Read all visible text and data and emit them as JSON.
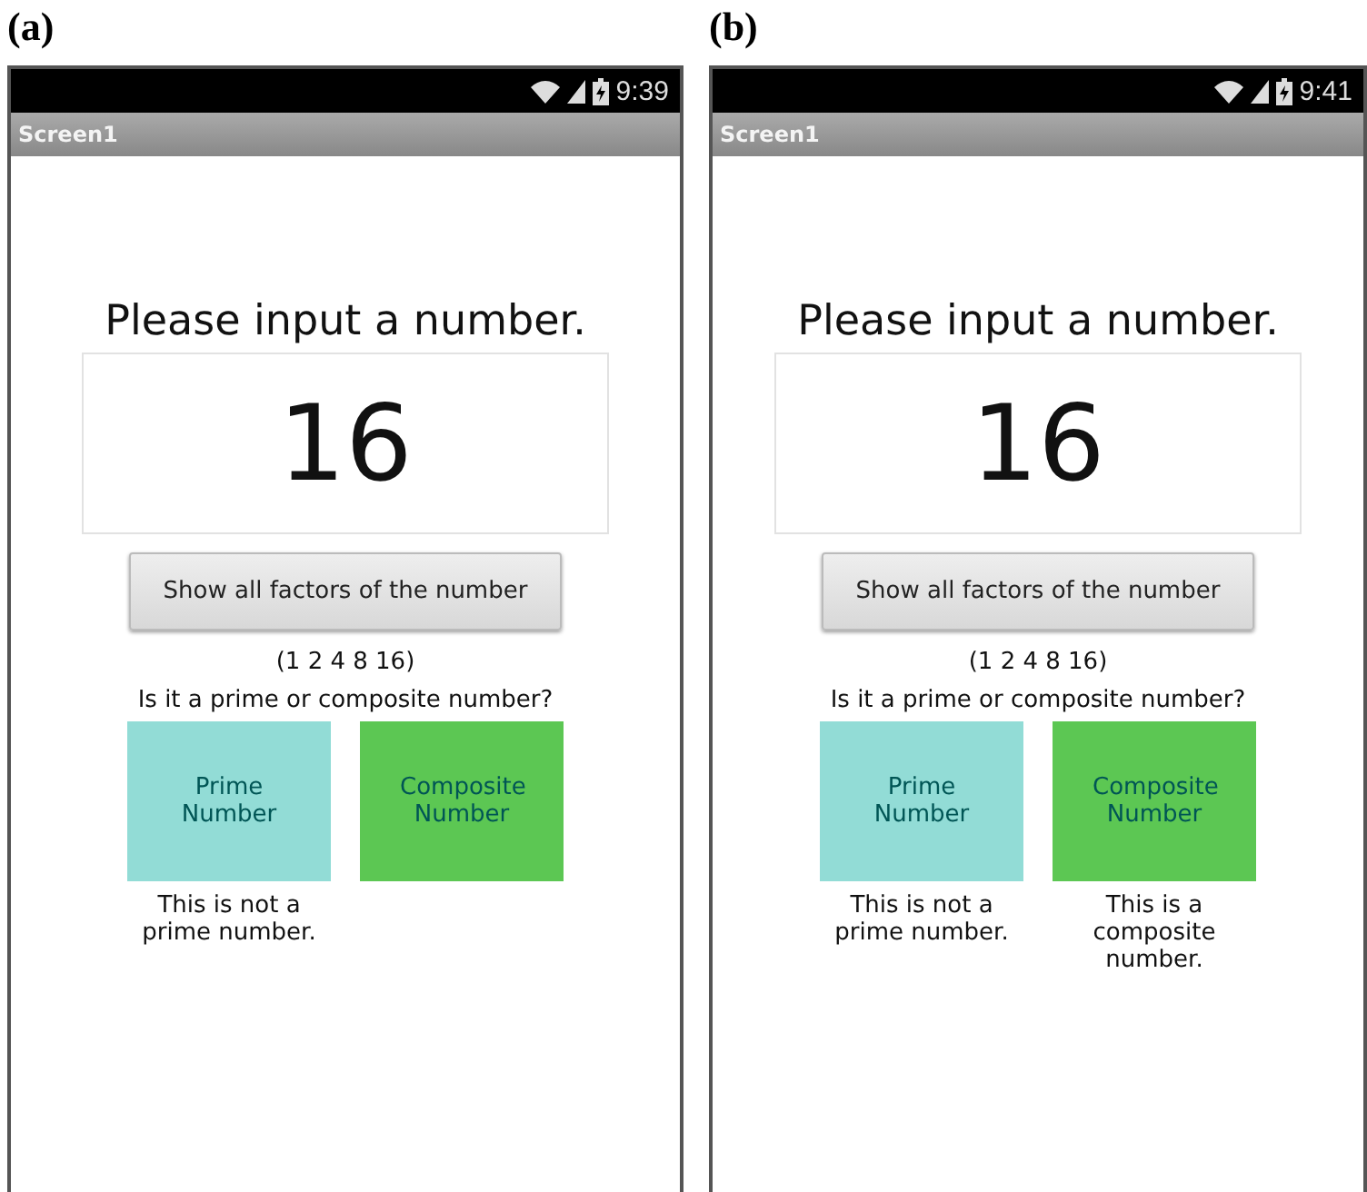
{
  "panels": [
    {
      "label": "(a)",
      "time": "9:39",
      "title": "Screen1",
      "prompt": "Please input a number.",
      "input": {
        "value": "16"
      },
      "button": "Show all factors of the number",
      "factors": "(1 2 4 8 16)",
      "question": "Is it a prime or composite number?",
      "choices": [
        {
          "label": "Prime Number",
          "color": "#92dcd6",
          "result": "This is not a prime number."
        },
        {
          "label": "Composite Number",
          "color": "#5cc753"
        }
      ]
    },
    {
      "label": "(b)",
      "time": "9:41",
      "title": "Screen1",
      "prompt": "Please input a number.",
      "input": {
        "value": "16"
      },
      "button": "Show all factors of the number",
      "factors": "(1 2 4 8 16)",
      "question": "Is it a prime or composite number?",
      "choices": [
        {
          "label": "Prime Number",
          "color": "#92dcd6",
          "result": "This is not a prime number."
        },
        {
          "label": "Composite Number",
          "color": "#5cc753",
          "result": "This is a composite number."
        }
      ]
    }
  ]
}
